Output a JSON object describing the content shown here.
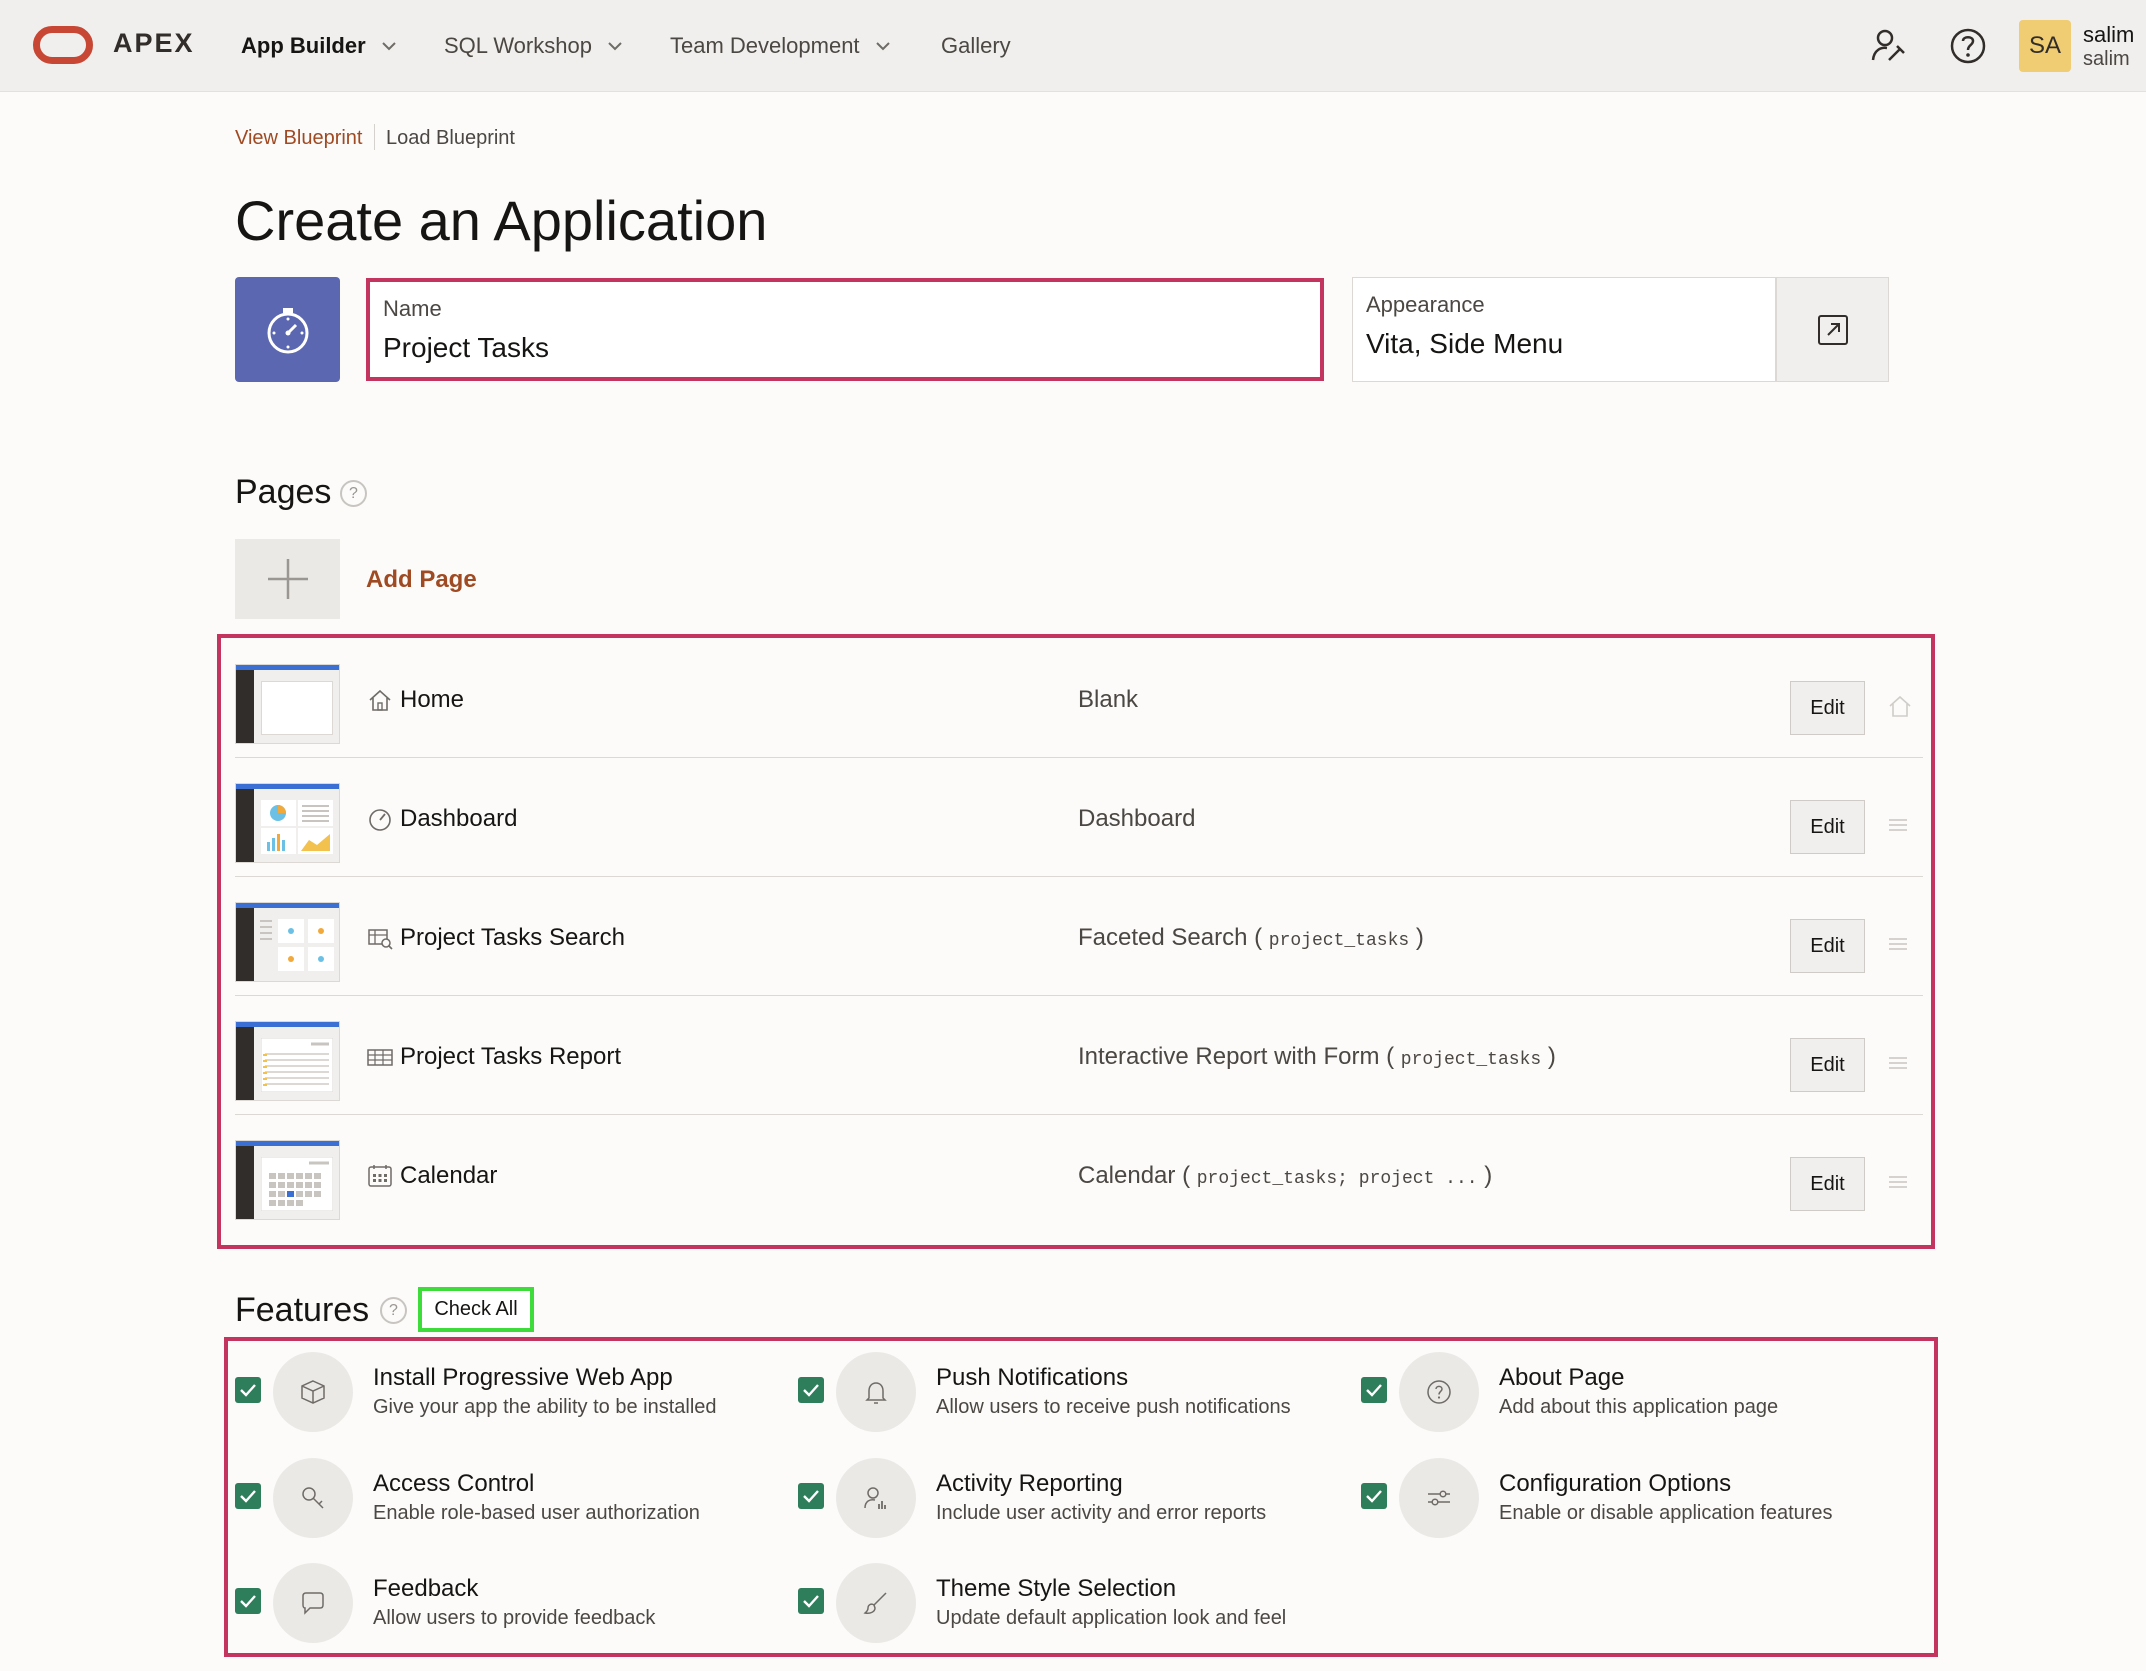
{
  "header": {
    "brand": "APEX",
    "nav": [
      {
        "label": "App Builder",
        "has_menu": true,
        "active": true
      },
      {
        "label": "SQL Workshop",
        "has_menu": true,
        "active": false
      },
      {
        "label": "Team Development",
        "has_menu": true,
        "active": false
      },
      {
        "label": "Gallery",
        "has_menu": false,
        "active": false
      }
    ],
    "user": {
      "initials": "SA",
      "name": "salim",
      "workspace": "salim"
    }
  },
  "breadcrumb": {
    "link": "View Blueprint",
    "current": "Load Blueprint"
  },
  "title": "Create an Application",
  "name_field": {
    "label": "Name",
    "value": "Project Tasks"
  },
  "appearance_field": {
    "label": "Appearance",
    "value": "Vita, Side Menu"
  },
  "pages": {
    "heading": "Pages",
    "add_label": "Add Page",
    "edit_label": "Edit",
    "items": [
      {
        "name": "Home",
        "type": "Blank",
        "source": "",
        "icon": "home-icon"
      },
      {
        "name": "Dashboard",
        "type": "Dashboard",
        "source": "",
        "icon": "dashboard-icon"
      },
      {
        "name": "Project Tasks Search",
        "type": "Faceted Search",
        "source": "project_tasks",
        "icon": "faceted-search-icon"
      },
      {
        "name": "Project Tasks Report",
        "type": "Interactive Report with Form",
        "source": "project_tasks",
        "icon": "report-icon"
      },
      {
        "name": "Calendar",
        "type": "Calendar",
        "source": "project_tasks; project ...",
        "icon": "calendar-icon"
      }
    ]
  },
  "features": {
    "heading": "Features",
    "check_all": "Check All",
    "items": [
      {
        "title": "Install Progressive Web App",
        "desc": "Give your app the ability to be installed",
        "checked": true,
        "icon": "package-icon"
      },
      {
        "title": "Push Notifications",
        "desc": "Allow users to receive push notifications",
        "checked": true,
        "icon": "bell-icon"
      },
      {
        "title": "About Page",
        "desc": "Add about this application page",
        "checked": true,
        "icon": "question-icon"
      },
      {
        "title": "Access Control",
        "desc": "Enable role-based user authorization",
        "checked": true,
        "icon": "key-icon"
      },
      {
        "title": "Activity Reporting",
        "desc": "Include user activity and error reports",
        "checked": true,
        "icon": "user-chart-icon"
      },
      {
        "title": "Configuration Options",
        "desc": "Enable or disable application features",
        "checked": true,
        "icon": "sliders-icon"
      },
      {
        "title": "Feedback",
        "desc": "Allow users to provide feedback",
        "checked": true,
        "icon": "comment-icon"
      },
      {
        "title": "Theme Style Selection",
        "desc": "Update default application look and feel",
        "checked": true,
        "icon": "brush-icon"
      }
    ]
  }
}
